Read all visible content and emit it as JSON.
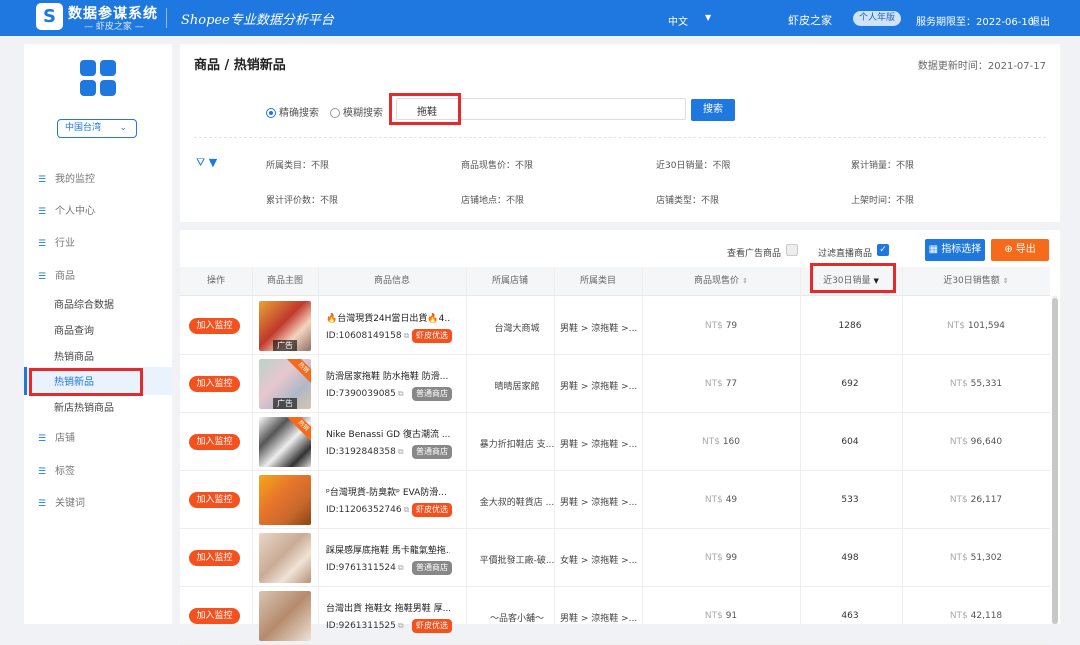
{
  "app": {
    "brand": "数据参谋系统",
    "brand_sub": "— 虾皮之家 —",
    "logo_letter": "S",
    "slogan": "Shopee专业数据分析平台",
    "language": "中文",
    "user": "虾皮之家",
    "plan": "个人年版",
    "expire": "服务期限至：2022-06-10",
    "logout": "退出"
  },
  "sidebar": {
    "region": "中国台湾",
    "nav": [
      {
        "label": "我的监控"
      },
      {
        "label": "个人中心"
      },
      {
        "label": "行业"
      },
      {
        "label": "商品"
      }
    ],
    "sub_items": [
      {
        "label": "商品综合数据"
      },
      {
        "label": "商品查询"
      },
      {
        "label": "热销商品"
      },
      {
        "label": "热销新品"
      },
      {
        "label": "新店热销商品"
      }
    ],
    "nav_bottom": [
      {
        "label": "店铺"
      },
      {
        "label": "标签"
      },
      {
        "label": "关键词"
      }
    ]
  },
  "filter": {
    "title": "商品 / 热销新品",
    "update_time": "数据更新时间：2021-07-17",
    "radio_exact": "精确搜索",
    "radio_fuzzy": "模糊搜索",
    "search_value": "拖鞋",
    "search_button": "搜索",
    "conditions": [
      "所属类目：不限",
      "商品现售价：不限",
      "近30日销量：不限",
      "累计销量：不限",
      "累计评价数：不限",
      "店铺地点：不限",
      "店铺类型：不限",
      "上架时间：不限"
    ]
  },
  "table": {
    "check_ad": "查看广告商品",
    "check_live": "过滤直播商品",
    "indicator_button": "指标选择",
    "export_button": "导出",
    "headers": [
      "操作",
      "商品主图",
      "商品信息",
      "所属店铺",
      "所属类目",
      "商品现售价",
      "近30日销量",
      "近30日销售额"
    ],
    "monitor_label": "加入监控",
    "rows": [
      {
        "name": "🔥台灣現貨24H當日出貨🔥4...",
        "id": "ID:10608149158",
        "tag": "虾皮优选",
        "tag_type": "shopee",
        "shop": "台灣大商城",
        "category": "男鞋 > 涼拖鞋 >...",
        "currency": "NT$",
        "price": "79",
        "sales": "1286",
        "amount": "101,594",
        "ad": "广告",
        "ribbon": ""
      },
      {
        "name": "防滑居家拖鞋 防水拖鞋 防滑...",
        "id": "ID:7390039085",
        "tag": "普通商店",
        "tag_type": "normal",
        "shop": "晴晴居家館",
        "category": "男鞋 > 涼拖鞋 >...",
        "currency": "NT$",
        "price": "77",
        "sales": "692",
        "amount": "55,331",
        "ad": "广告",
        "ribbon": "热销"
      },
      {
        "name": "Nike Benassi GD 復古潮流 ...",
        "id": "ID:3192848358",
        "tag": "普通商店",
        "tag_type": "normal",
        "shop": "暴力折扣鞋店 支...",
        "category": "男鞋 > 涼拖鞋 >...",
        "currency": "NT$",
        "price": "160",
        "sales": "604",
        "amount": "96,640",
        "ad": "",
        "ribbon": "热销"
      },
      {
        "name": "ᵖ台灣現貨-防臭款ᵖ EVA防滑...",
        "id": "ID:11206352746",
        "tag": "虾皮优选",
        "tag_type": "shopee",
        "shop": "金大叔的鞋貨店 ...",
        "category": "男鞋 > 涼拖鞋 >...",
        "currency": "NT$",
        "price": "49",
        "sales": "533",
        "amount": "26,117",
        "ad": "",
        "ribbon": ""
      },
      {
        "name": "踩屎感厚底拖鞋 馬卡龍氣墊拖...",
        "id": "ID:9761311524",
        "tag": "普通商店",
        "tag_type": "normal",
        "shop": "平價批發工廠-破...",
        "category": "女鞋 > 涼拖鞋 >...",
        "currency": "NT$",
        "price": "99",
        "sales": "498",
        "amount": "51,302",
        "ad": "",
        "ribbon": ""
      },
      {
        "name": "台灣出貨 拖鞋女 拖鞋男鞋 厚...",
        "id": "ID:9261311525",
        "tag": "虾皮优选",
        "tag_type": "shopee",
        "shop": "～品客小舖～",
        "category": "男鞋 > 涼拖鞋 >...",
        "currency": "NT$",
        "price": "91",
        "sales": "463",
        "amount": "42,118",
        "ad": "",
        "ribbon": ""
      }
    ]
  },
  "colors": {
    "primary": "#1e78e0",
    "accent": "#f4511e",
    "highlight": "#e42a2a"
  }
}
